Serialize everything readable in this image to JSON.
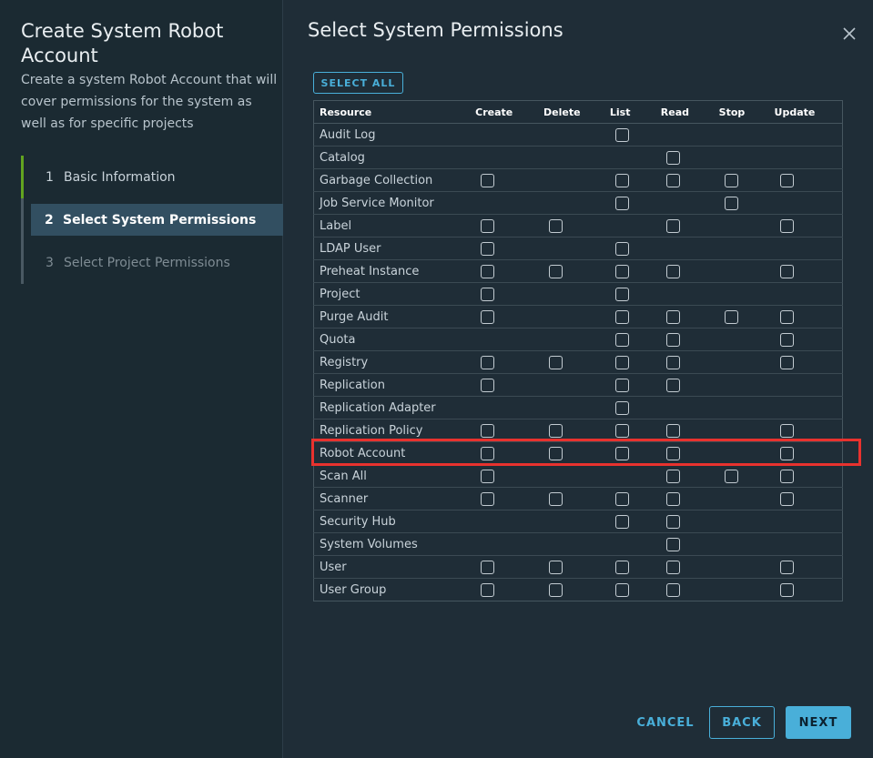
{
  "sidebar": {
    "title": "Create System Robot Account",
    "description": "Create a system Robot Account that will cover permissions for the system as well as for specific projects",
    "steps": [
      {
        "num": "1",
        "label": "Basic Information",
        "state": "done"
      },
      {
        "num": "2",
        "label": "Select System Permissions",
        "state": "active"
      },
      {
        "num": "3",
        "label": "Select Project Permissions",
        "state": "future"
      }
    ]
  },
  "main": {
    "title": "Select System Permissions",
    "select_all_label": "SELECT ALL"
  },
  "table": {
    "headers": {
      "resource": "Resource",
      "create": "Create",
      "delete": "Delete",
      "list": "List",
      "read": "Read",
      "stop": "Stop",
      "update": "Update"
    },
    "columns": [
      "create",
      "delete",
      "list",
      "read",
      "stop",
      "update"
    ],
    "rows": [
      {
        "name": "Audit Log",
        "perms": [
          false,
          false,
          true,
          false,
          false,
          false
        ]
      },
      {
        "name": "Catalog",
        "perms": [
          false,
          false,
          false,
          true,
          false,
          false
        ]
      },
      {
        "name": "Garbage Collection",
        "perms": [
          true,
          false,
          true,
          true,
          true,
          true
        ]
      },
      {
        "name": "Job Service Monitor",
        "perms": [
          false,
          false,
          true,
          false,
          true,
          false
        ]
      },
      {
        "name": "Label",
        "perms": [
          true,
          true,
          false,
          true,
          false,
          true
        ]
      },
      {
        "name": "LDAP User",
        "perms": [
          true,
          false,
          true,
          false,
          false,
          false
        ]
      },
      {
        "name": "Preheat Instance",
        "perms": [
          true,
          true,
          true,
          true,
          false,
          true
        ]
      },
      {
        "name": "Project",
        "perms": [
          true,
          false,
          true,
          false,
          false,
          false
        ]
      },
      {
        "name": "Purge Audit",
        "perms": [
          true,
          false,
          true,
          true,
          true,
          true
        ]
      },
      {
        "name": "Quota",
        "perms": [
          false,
          false,
          true,
          true,
          false,
          true
        ]
      },
      {
        "name": "Registry",
        "perms": [
          true,
          true,
          true,
          true,
          false,
          true
        ]
      },
      {
        "name": "Replication",
        "perms": [
          true,
          false,
          true,
          true,
          false,
          false
        ]
      },
      {
        "name": "Replication Adapter",
        "perms": [
          false,
          false,
          true,
          false,
          false,
          false
        ]
      },
      {
        "name": "Replication Policy",
        "perms": [
          true,
          true,
          true,
          true,
          false,
          true
        ]
      },
      {
        "name": "Robot Account",
        "perms": [
          true,
          true,
          true,
          true,
          false,
          true
        ]
      },
      {
        "name": "Scan All",
        "perms": [
          true,
          false,
          false,
          true,
          true,
          true
        ]
      },
      {
        "name": "Scanner",
        "perms": [
          true,
          true,
          true,
          true,
          false,
          true
        ]
      },
      {
        "name": "Security Hub",
        "perms": [
          false,
          false,
          true,
          true,
          false,
          false
        ]
      },
      {
        "name": "System Volumes",
        "perms": [
          false,
          false,
          false,
          true,
          false,
          false
        ]
      },
      {
        "name": "User",
        "perms": [
          true,
          true,
          true,
          true,
          false,
          true
        ]
      },
      {
        "name": "User Group",
        "perms": [
          true,
          true,
          true,
          true,
          false,
          true
        ]
      }
    ]
  },
  "footer": {
    "cancel_label": "CANCEL",
    "back_label": "BACK",
    "next_label": "NEXT"
  },
  "colors": {
    "accent": "#49afd9",
    "step_done": "#62a420",
    "highlight": "#e8322e",
    "active_step_bg": "#324f61"
  },
  "icons": {
    "close": "close-icon"
  }
}
